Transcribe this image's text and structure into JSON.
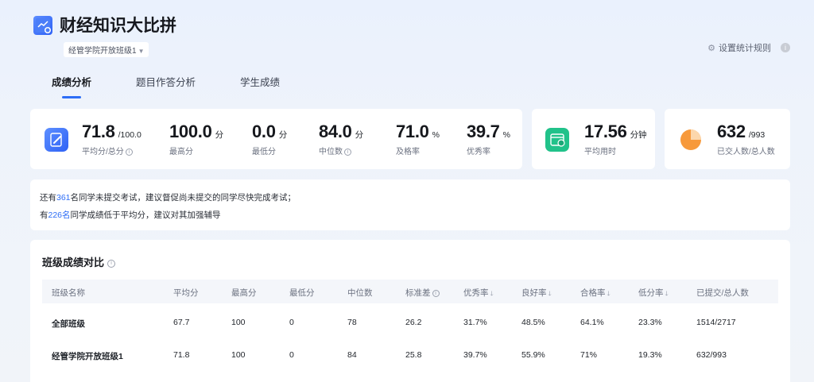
{
  "header": {
    "title": "财经知识大比拼",
    "class_select": "经管学院开放班级1",
    "settings_label": "设置统计规则"
  },
  "tabs": [
    {
      "label": "成绩分析",
      "active": true
    },
    {
      "label": "题目作答分析",
      "active": false
    },
    {
      "label": "学生成绩",
      "active": false
    }
  ],
  "stats": {
    "avg": {
      "value": "71.8",
      "unit": "/100.0",
      "label": "平均分/总分"
    },
    "max": {
      "value": "100.0",
      "unit": "分",
      "label": "最高分"
    },
    "min": {
      "value": "0.0",
      "unit": "分",
      "label": "最低分"
    },
    "median": {
      "value": "84.0",
      "unit": "分",
      "label": "中位数"
    },
    "pass": {
      "value": "71.0",
      "unit": "%",
      "label": "及格率"
    },
    "excellent": {
      "value": "39.7",
      "unit": "%",
      "label": "优秀率"
    },
    "time": {
      "value": "17.56",
      "unit": "分钟",
      "label": "平均用时"
    },
    "submitted": {
      "value": "632",
      "unit": "/993",
      "label": "已交人数/总人数"
    }
  },
  "notice": {
    "line1_pre": "还有",
    "line1_num": "361",
    "line1_post": "名同学未提交考试，建议督促尚未提交的同学尽快完成考试；",
    "line2_pre": "有",
    "line2_num": "226名",
    "line2_post": "同学成绩低于平均分，建议对其加强辅导"
  },
  "compare": {
    "title": "班级成绩对比",
    "columns": [
      "班级名称",
      "平均分",
      "最高分",
      "最低分",
      "中位数",
      "标准差",
      "优秀率",
      "良好率",
      "合格率",
      "低分率",
      "已提交/总人数"
    ],
    "rows": [
      [
        "全部班级",
        "67.7",
        "100",
        "0",
        "78",
        "26.2",
        "31.7%",
        "48.5%",
        "64.1%",
        "23.3%",
        "1514/2717"
      ],
      [
        "经管学院开放班级1",
        "71.8",
        "100",
        "0",
        "84",
        "25.8",
        "39.7%",
        "55.9%",
        "71%",
        "19.3%",
        "632/993"
      ]
    ]
  },
  "colors": {
    "accent": "#2d6df6",
    "icon_blue": "#3f74f6",
    "icon_green": "#21c28a",
    "icon_orange": "#f7993b"
  },
  "icons": {
    "logo": "chart-book-icon",
    "settings": "gear-icon",
    "avg": "pencil-icon",
    "time": "calendar-clock-icon",
    "submitted": "pie-chart-icon"
  }
}
